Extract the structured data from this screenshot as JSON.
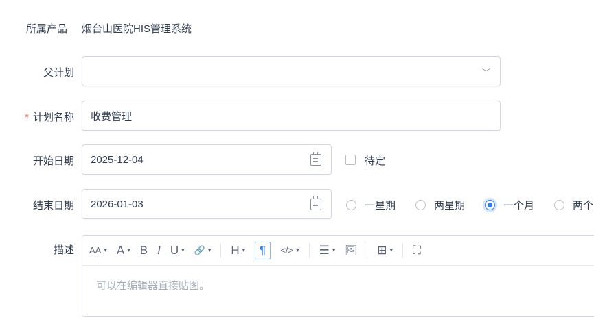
{
  "product": {
    "label": "所属产品",
    "value": "烟台山医院HIS管理系统"
  },
  "parent_plan": {
    "label": "父计划",
    "value": ""
  },
  "plan_name": {
    "label": "计划名称",
    "required_mark": "*",
    "value": "收费管理"
  },
  "start_date": {
    "label": "开始日期",
    "value": "2025-12-04",
    "pending_label": "待定",
    "pending_checked": false
  },
  "end_date": {
    "label": "结束日期",
    "value": "2026-01-03",
    "options": [
      {
        "label": "一星期",
        "selected": false
      },
      {
        "label": "两星期",
        "selected": false
      },
      {
        "label": "一个月",
        "selected": true
      },
      {
        "label": "两个",
        "selected": false
      }
    ]
  },
  "description": {
    "label": "描述",
    "placeholder": "可以在编辑器直接贴图。",
    "toolbar": {
      "font_size": "AA",
      "font_color": "A",
      "bold": "B",
      "italic": "I",
      "underline": "U",
      "link": "🔗",
      "heading": "H",
      "paragraph": "¶",
      "code": "</>",
      "list": "☰",
      "image": "🖼",
      "table": "⊞",
      "fullscreen": "⛶"
    }
  },
  "colors": {
    "accent": "#2e7ff7",
    "required": "#f56c6c",
    "border": "#d4d7e3"
  }
}
